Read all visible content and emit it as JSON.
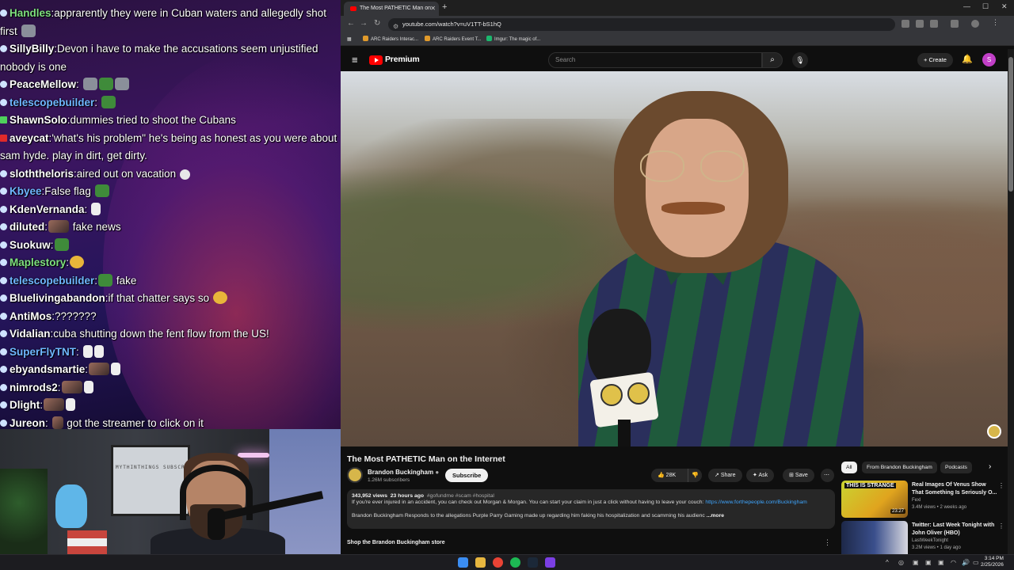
{
  "chat": {
    "messages": [
      {
        "user": "Handles",
        "text": "apprarently they were in Cuban waters and allegedly shot first",
        "color": "#7ee07e"
      },
      {
        "user": "SillyBilly",
        "text": "Devon i have to make the accusations seem unjustified nobody is one",
        "color": "#ffffff"
      },
      {
        "user": "PeaceMellow",
        "text": "",
        "color": "#ffffff"
      },
      {
        "user": "telescopebuilder",
        "text": "",
        "color": "#6fb7ff"
      },
      {
        "user": "ShawnSolo",
        "text": "dummies tried to shoot the Cubans",
        "color": "#ffffff"
      },
      {
        "user": "aveycat",
        "text": "'what's his problem\" he's being as honest as you were about sam hyde. play in dirt, get dirty.",
        "color": "#ffffff"
      },
      {
        "user": "sloththeloris",
        "text": "aired out on vacation",
        "color": "#ffffff"
      },
      {
        "user": "Kbyee",
        "text": "False flag",
        "color": "#6fb7ff"
      },
      {
        "user": "KdenVernanda",
        "text": "",
        "color": "#ffffff"
      },
      {
        "user": "diluted",
        "text": "fake news",
        "color": "#ffffff"
      },
      {
        "user": "Suokuw",
        "text": "",
        "color": "#ffffff"
      },
      {
        "user": "Maplestory",
        "text": "",
        "color": "#7ee07e"
      },
      {
        "user": "telescopebuilder",
        "text": "fake",
        "color": "#6fb7ff"
      },
      {
        "user": "Bluelivingabandon",
        "text": "if that chatter says so",
        "color": "#ffffff"
      },
      {
        "user": "AntiMos",
        "text": "???????",
        "color": "#ffffff"
      },
      {
        "user": "Vidalian",
        "text": "cuba shutting down the fent flow from the US!",
        "color": "#ffffff"
      },
      {
        "user": "SuperFlyTNT",
        "text": "",
        "color": "#6fb7ff"
      },
      {
        "user": "ebyandsmartie",
        "text": "",
        "color": "#ffffff"
      },
      {
        "user": "nimrods2",
        "text": "",
        "color": "#ffffff"
      },
      {
        "user": "Dlight",
        "text": "",
        "color": "#ffffff"
      },
      {
        "user": "Jureon",
        "text": "got the streamer to click on it",
        "color": "#ffffff"
      }
    ]
  },
  "webcam": {
    "shelf_text": "MYTHINTHINGS SUBSCRIBED"
  },
  "browser": {
    "tab_title": "The Most PATHETIC Man on",
    "url": "youtube.com/watch?v=uV1TT-bS1hQ",
    "bookmarks": [
      "ARC Raiders Interac...",
      "ARC Raiders Event T...",
      "Imgur: The magic of..."
    ]
  },
  "youtube": {
    "brand": "Premium",
    "search_placeholder": "Search",
    "create_label": "Create",
    "avatar_letter": "S",
    "video_title": "The Most PATHETIC Man on the Internet",
    "channel_name": "Brandon Buckingham",
    "subscribers": "1.26M subscribers",
    "subscribe_label": "Subscribe",
    "likes": "28K",
    "share_label": "Share",
    "ask_label": "Ask",
    "save_label": "Save",
    "views": "343,952 views",
    "posted": "23 hours ago",
    "tags": "#gofundme #scam #hospital",
    "desc_line1": "If you're ever injured in an accident, you can check out Morgan & Morgan. You can start your claim in just a click without having to leave your couch:",
    "desc_link": "https://www.forthepeople.com/Buckingham",
    "desc_line2": "Brandon Buckingham Responds to the allegations Purple Parry Gaming made up regarding him faking his hospitalization and scamming his audienc",
    "more_label": "...more",
    "store_label": "Shop the Brandon Buckingham store",
    "chips": [
      "All",
      "From Brandon Buckingham",
      "Podcasts"
    ],
    "related": [
      {
        "title": "Real Images Of Venus Show That Something Is Seriously O...",
        "channel": "Fexl",
        "meta": "3.4M views • 2 weeks ago",
        "duration": "23:27",
        "thumb_text": "THIS IS STRANGE"
      },
      {
        "title": "Twitter: Last Week Tonight with John Oliver (HBO)",
        "channel": "LastWeekTonight",
        "meta": "3.2M views • 1 day ago",
        "duration": "",
        "thumb_text": ""
      }
    ]
  },
  "taskbar": {
    "time": "3:14 PM",
    "date": "2/25/2026"
  }
}
